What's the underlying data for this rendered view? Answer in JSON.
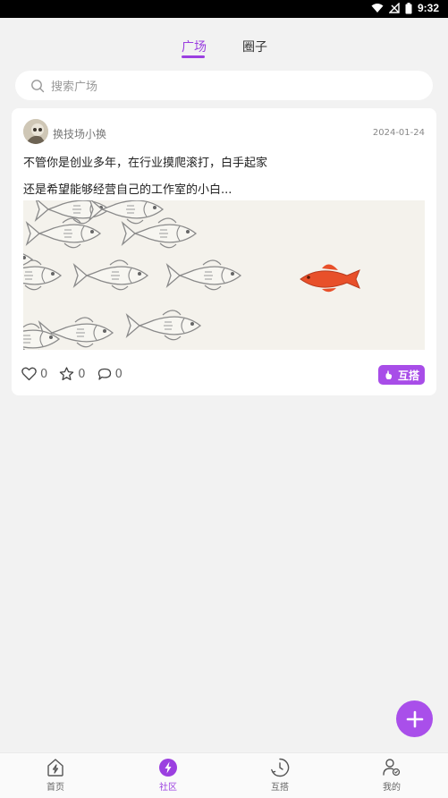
{
  "status_bar": {
    "time": "9:32",
    "icons": [
      "wifi-icon",
      "signal-icon",
      "battery-icon"
    ]
  },
  "tabs": [
    {
      "label": "广场",
      "active": true
    },
    {
      "label": "圈子",
      "active": false
    }
  ],
  "search": {
    "placeholder": "搜索广场",
    "icon": "search-icon"
  },
  "post": {
    "author": "换技场小换",
    "date": "2024-01-24",
    "line1": "不管你是创业多年，在行业摸爬滚打，白手起家",
    "line2": "还是希望能够经营自己的工作室的小白...",
    "likes": "0",
    "stars": "0",
    "comments": "0",
    "tag": "互搭"
  },
  "bottom_nav": [
    {
      "label": "首页",
      "icon": "home-icon",
      "active": false
    },
    {
      "label": "社区",
      "icon": "lightning-icon",
      "active": true
    },
    {
      "label": "互搭",
      "icon": "clock-icon",
      "active": false
    },
    {
      "label": "我的",
      "icon": "user-icon",
      "active": false
    }
  ],
  "colors": {
    "accent": "#9b3fe0",
    "background": "#f2f2f2",
    "fish_red": "#e8502a"
  }
}
